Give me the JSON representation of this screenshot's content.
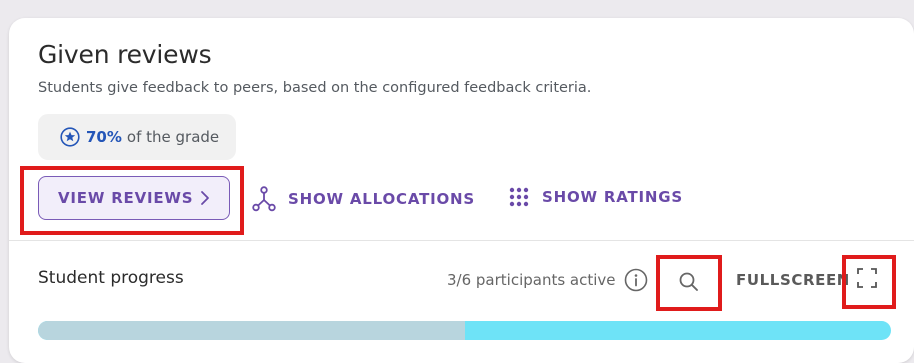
{
  "card": {
    "title": "Given reviews",
    "subtitle": "Students give feedback to peers, based on the configured feedback criteria.",
    "grade": {
      "percent": "70%",
      "suffix": "of the grade",
      "icon": "star-circle-icon"
    }
  },
  "actions": {
    "view_reviews": "VIEW REVIEWS",
    "show_allocations": "SHOW ALLOCATIONS",
    "show_ratings": "SHOW RATINGS"
  },
  "progress": {
    "label": "Student progress",
    "participants": "3/6 participants active",
    "fullscreen": "FULLSCREEN",
    "fraction": 0.5
  },
  "colors": {
    "accent": "#6a4aa8",
    "grade_percent": "#2456b8",
    "highlight": "#e01b1b",
    "progress_done": "#b8d5de",
    "progress_remaining": "#6ee3f7"
  }
}
